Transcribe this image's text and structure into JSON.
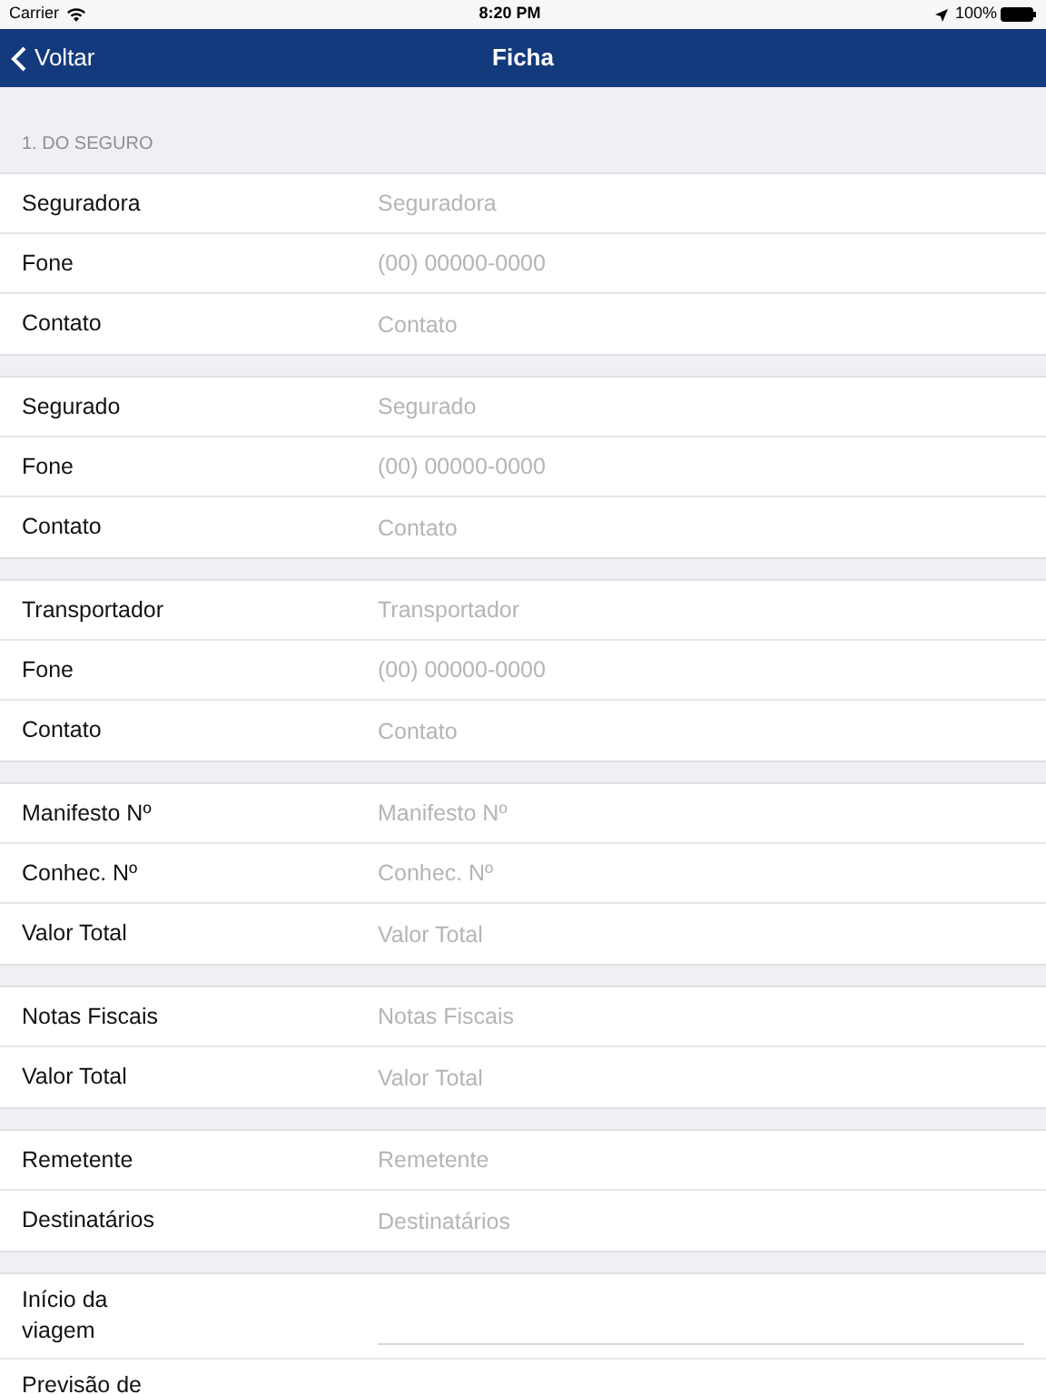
{
  "status_bar": {
    "carrier": "Carrier",
    "time": "8:20 PM",
    "battery": "100%"
  },
  "nav": {
    "back": "Voltar",
    "title": "Ficha"
  },
  "section": {
    "title": "1. DO SEGURO"
  },
  "groups": [
    {
      "rows": [
        {
          "kind": "text",
          "label": "Seguradora",
          "placeholder": "Seguradora"
        },
        {
          "kind": "text",
          "label": "Fone",
          "placeholder": "(00) 00000-0000"
        },
        {
          "kind": "text",
          "label": "Contato",
          "placeholder": "Contato"
        }
      ]
    },
    {
      "rows": [
        {
          "kind": "text",
          "label": "Segurado",
          "placeholder": "Segurado"
        },
        {
          "kind": "text",
          "label": "Fone",
          "placeholder": "(00) 00000-0000"
        },
        {
          "kind": "text",
          "label": "Contato",
          "placeholder": "Contato"
        }
      ]
    },
    {
      "rows": [
        {
          "kind": "text",
          "label": "Transportador",
          "placeholder": "Transportador"
        },
        {
          "kind": "text",
          "label": "Fone",
          "placeholder": "(00) 00000-0000"
        },
        {
          "kind": "text",
          "label": "Contato",
          "placeholder": "Contato"
        }
      ]
    },
    {
      "rows": [
        {
          "kind": "text",
          "label": "Manifesto Nº",
          "placeholder": "Manifesto Nº"
        },
        {
          "kind": "text",
          "label": "Conhec. Nº",
          "placeholder": "Conhec. Nº"
        },
        {
          "kind": "text",
          "label": "Valor Total",
          "placeholder": "Valor Total"
        }
      ]
    },
    {
      "rows": [
        {
          "kind": "text",
          "label": "Notas Fiscais",
          "placeholder": "Notas Fiscais"
        },
        {
          "kind": "text",
          "label": "Valor Total",
          "placeholder": "Valor Total"
        }
      ]
    },
    {
      "rows": [
        {
          "kind": "text",
          "label": "Remetente",
          "placeholder": "Remetente"
        },
        {
          "kind": "text",
          "label": "Destinatários",
          "placeholder": "Destinatários"
        }
      ]
    },
    {
      "rows": [
        {
          "kind": "date",
          "label": "Início da viagem"
        },
        {
          "kind": "date",
          "label": "Previsão de"
        }
      ]
    }
  ]
}
